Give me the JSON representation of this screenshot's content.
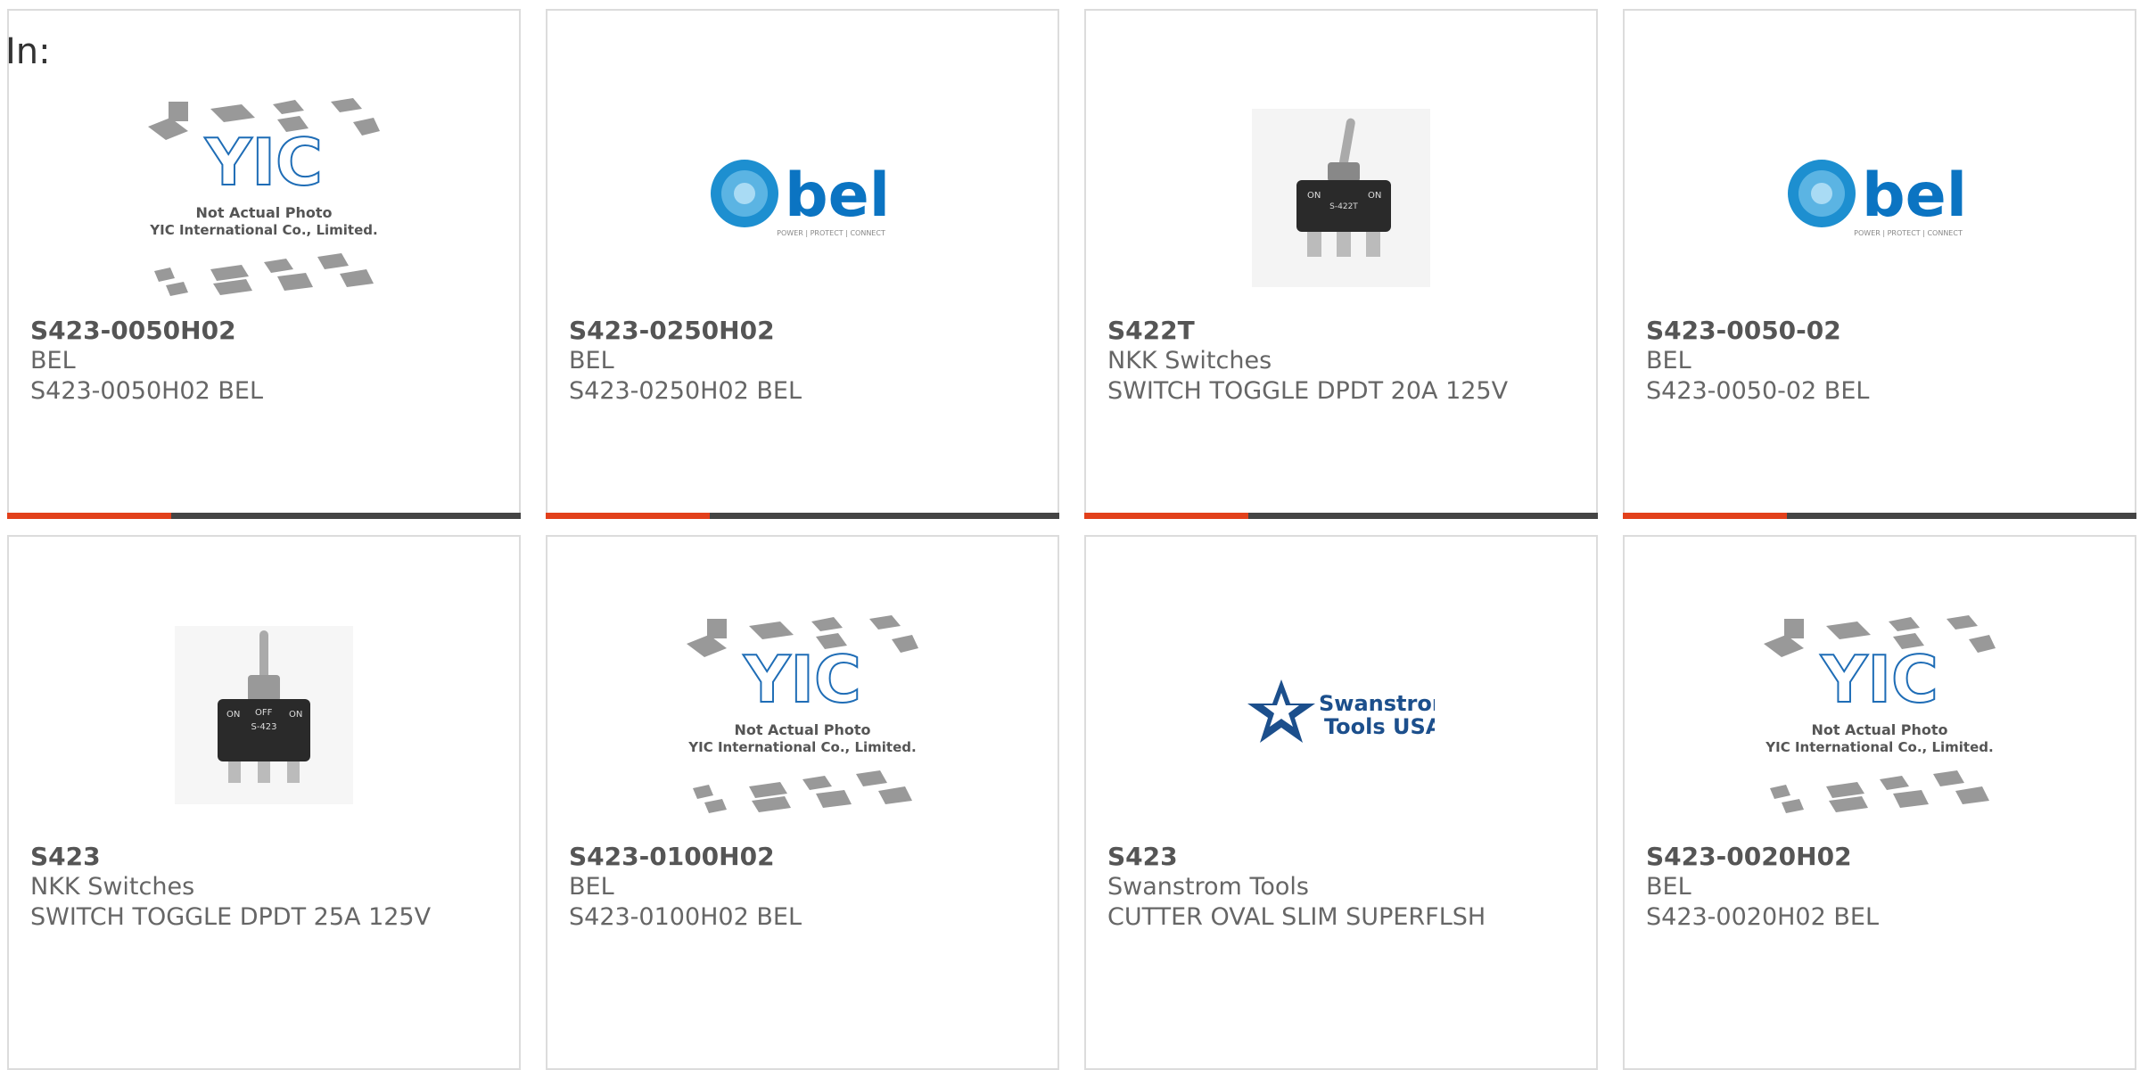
{
  "header": {
    "in_label": "In:"
  },
  "placeholder": {
    "logo": "YIC",
    "line1": "Not Actual Photo",
    "line2": "YIC International Co., Limited."
  },
  "bel_logo": {
    "word": "bel",
    "tagline": "POWER | PROTECT | CONNECT"
  },
  "toggle_1": {
    "left": "ON",
    "right": "ON",
    "model": "S-422T"
  },
  "toggle_2": {
    "left": "ON",
    "middle": "OFF",
    "right": "ON",
    "model": "S-423"
  },
  "swanstrom_logo": {
    "line1": "Swanstrom",
    "line2": "Tools USA"
  },
  "colors": {
    "accent": "#e2401b",
    "bar_dark": "#444444",
    "bel_blue": "#1d8fd0"
  },
  "products": [
    {
      "part": "S423-0050H02",
      "manufacturer": "BEL",
      "description": "S423-0050H02 BEL"
    },
    {
      "part": "S423-0250H02",
      "manufacturer": "BEL",
      "description": "S423-0250H02 BEL"
    },
    {
      "part": "S422T",
      "manufacturer": "NKK Switches",
      "description": "SWITCH TOGGLE DPDT 20A 125V"
    },
    {
      "part": "S423-0050-02",
      "manufacturer": "BEL",
      "description": "S423-0050-02 BEL"
    },
    {
      "part": "S423",
      "manufacturer": "NKK Switches",
      "description": "SWITCH TOGGLE DPDT 25A 125V"
    },
    {
      "part": "S423-0100H02",
      "manufacturer": "BEL",
      "description": "S423-0100H02 BEL"
    },
    {
      "part": "S423",
      "manufacturer": "Swanstrom Tools",
      "description": "CUTTER OVAL SLIM SUPERFLSH"
    },
    {
      "part": "S423-0020H02",
      "manufacturer": "BEL",
      "description": "S423-0020H02 BEL"
    }
  ]
}
